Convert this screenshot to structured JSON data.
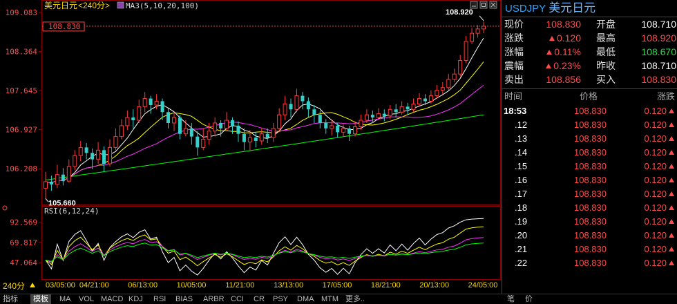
{
  "header": {
    "title": "美元日元",
    "period": "<240分>",
    "ma_label": "MA3(5,10,20,100)",
    "rsi_label": "RSI(6,12,24)",
    "current_price_tag": "108.830",
    "high_marker": "108.920",
    "low_marker": "105.660",
    "period_button": "240分"
  },
  "chart_data": {
    "type": "candlestick",
    "title": "美元日元 <240分>",
    "y_ticks": [
      "109.083",
      "108.364",
      "107.645",
      "106.927",
      "106.208"
    ],
    "ylim": [
      105.55,
      109.083
    ],
    "x_ticks": [
      "03/05:00",
      "04/21:00",
      "06/13:00",
      "10/05:00",
      "11/21:00",
      "13/13:00",
      "17/05:00",
      "18/21:00",
      "20/13:00",
      "24/05:00"
    ],
    "high": 108.92,
    "low": 105.66,
    "current": 108.83,
    "candles": [
      [
        105.85,
        105.97,
        105.66,
        106.15
      ],
      [
        105.97,
        105.92,
        105.8,
        106.08
      ],
      [
        105.92,
        106.1,
        105.85,
        106.28
      ],
      [
        106.1,
        105.98,
        105.9,
        106.22
      ],
      [
        105.98,
        106.25,
        105.95,
        106.38
      ],
      [
        106.25,
        106.45,
        106.18,
        106.55
      ],
      [
        106.45,
        106.6,
        106.35,
        106.72
      ],
      [
        106.6,
        106.5,
        106.38,
        106.68
      ],
      [
        106.5,
        106.38,
        106.2,
        106.58
      ],
      [
        106.38,
        106.55,
        106.3,
        106.7
      ],
      [
        106.55,
        106.3,
        106.15,
        106.62
      ],
      [
        106.3,
        106.6,
        106.25,
        106.75
      ],
      [
        106.6,
        106.8,
        106.55,
        106.95
      ],
      [
        106.8,
        107.0,
        106.75,
        107.12
      ],
      [
        107.0,
        107.15,
        106.92,
        107.28
      ],
      [
        107.15,
        107.1,
        106.95,
        107.3
      ],
      [
        107.1,
        107.35,
        107.05,
        107.48
      ],
      [
        107.35,
        107.5,
        107.25,
        107.62
      ],
      [
        107.5,
        107.38,
        107.22,
        107.55
      ],
      [
        107.38,
        107.45,
        107.3,
        107.58
      ],
      [
        107.45,
        107.25,
        107.1,
        107.5
      ],
      [
        107.25,
        107.05,
        106.95,
        107.32
      ],
      [
        107.05,
        107.15,
        106.9,
        107.25
      ],
      [
        107.15,
        106.85,
        106.75,
        107.2
      ],
      [
        106.85,
        106.95,
        106.8,
        107.1
      ],
      [
        106.95,
        106.8,
        106.65,
        107.05
      ],
      [
        106.8,
        106.6,
        106.45,
        106.9
      ],
      [
        106.6,
        106.75,
        106.55,
        106.95
      ],
      [
        106.75,
        106.9,
        106.65,
        107.05
      ],
      [
        106.9,
        107.05,
        106.8,
        107.15
      ],
      [
        107.05,
        106.95,
        106.8,
        107.1
      ],
      [
        106.95,
        107.1,
        106.9,
        107.25
      ],
      [
        107.1,
        107.0,
        106.85,
        107.15
      ],
      [
        107.0,
        106.85,
        106.7,
        107.08
      ],
      [
        106.85,
        106.7,
        106.55,
        106.95
      ],
      [
        106.7,
        106.78,
        106.55,
        106.92
      ],
      [
        106.78,
        106.72,
        106.6,
        106.88
      ],
      [
        106.72,
        106.85,
        106.65,
        106.95
      ],
      [
        106.85,
        106.78,
        106.68,
        106.95
      ],
      [
        106.78,
        106.95,
        106.7,
        107.05
      ],
      [
        106.95,
        107.2,
        106.9,
        107.32
      ],
      [
        107.2,
        107.4,
        107.1,
        107.55
      ],
      [
        107.4,
        107.3,
        107.15,
        107.5
      ],
      [
        107.3,
        107.55,
        107.25,
        107.68
      ],
      [
        107.55,
        107.45,
        107.3,
        107.62
      ],
      [
        107.45,
        107.3,
        107.15,
        107.52
      ],
      [
        107.3,
        107.2,
        107.05,
        107.38
      ],
      [
        107.2,
        107.05,
        106.95,
        107.28
      ],
      [
        107.05,
        106.95,
        106.85,
        107.12
      ],
      [
        106.95,
        107.0,
        106.82,
        107.1
      ],
      [
        107.0,
        106.88,
        106.78,
        107.05
      ],
      [
        106.88,
        106.95,
        106.8,
        107.02
      ],
      [
        106.95,
        106.85,
        106.72,
        107.0
      ],
      [
        106.85,
        106.98,
        106.8,
        107.08
      ],
      [
        106.98,
        107.1,
        106.92,
        107.2
      ],
      [
        107.1,
        107.2,
        107.05,
        107.3
      ],
      [
        107.2,
        107.15,
        107.05,
        107.28
      ],
      [
        107.15,
        107.22,
        107.1,
        107.32
      ],
      [
        107.22,
        107.18,
        107.08,
        107.3
      ],
      [
        107.18,
        107.3,
        107.12,
        107.38
      ],
      [
        107.3,
        107.25,
        107.15,
        107.4
      ],
      [
        107.25,
        107.35,
        107.2,
        107.45
      ],
      [
        107.35,
        107.3,
        107.2,
        107.42
      ],
      [
        107.3,
        107.4,
        107.25,
        107.5
      ],
      [
        107.4,
        107.5,
        107.35,
        107.6
      ],
      [
        107.5,
        107.45,
        107.38,
        107.58
      ],
      [
        107.45,
        107.55,
        107.4,
        107.65
      ],
      [
        107.55,
        107.65,
        107.5,
        107.75
      ],
      [
        107.65,
        107.7,
        107.58,
        107.8
      ],
      [
        107.7,
        107.85,
        107.65,
        107.95
      ],
      [
        107.85,
        107.95,
        107.8,
        108.05
      ],
      [
        107.95,
        108.2,
        107.9,
        108.3
      ],
      [
        108.2,
        108.55,
        108.15,
        108.65
      ],
      [
        108.55,
        108.7,
        108.5,
        108.8
      ],
      [
        108.7,
        108.78,
        108.62,
        108.85
      ],
      [
        108.78,
        108.83,
        108.7,
        108.92
      ]
    ],
    "ma_series": [
      {
        "name": "MA5",
        "color": "#ffffff"
      },
      {
        "name": "MA10",
        "color": "#ffff00"
      },
      {
        "name": "MA20",
        "color": "#ff33ff"
      },
      {
        "name": "MA100",
        "color": "#00ff00"
      }
    ],
    "rsi": {
      "y_ticks": [
        "92.569",
        "69.817",
        "47.064"
      ],
      "ylim": [
        30,
        100
      ],
      "series": [
        {
          "name": "RSI6",
          "color": "#ffffff"
        },
        {
          "name": "RSI12",
          "color": "#ffff00"
        },
        {
          "name": "RSI24",
          "color": "#ff33ff"
        }
      ]
    }
  },
  "quote": {
    "symbol": "USDJPY",
    "name": "美元日元",
    "rows": [
      {
        "k": "现价",
        "v": "108.830",
        "vc": "red",
        "k2": "开盘",
        "v2": "108.710",
        "v2c": "white"
      },
      {
        "k": "涨跌",
        "v": "0.120",
        "vc": "red",
        "arrow": true,
        "k2": "最高",
        "v2": "108.920",
        "v2c": "red"
      },
      {
        "k": "涨幅",
        "v": "0.11%",
        "vc": "red",
        "arrow": true,
        "k2": "最低",
        "v2": "108.670",
        "v2c": "green"
      },
      {
        "k": "震幅",
        "v": "0.23%",
        "vc": "red",
        "arrow": true,
        "k2": "昨收",
        "v2": "108.710",
        "v2c": "white"
      },
      {
        "k": "卖出",
        "v": "108.856",
        "vc": "red",
        "k2": "买入",
        "v2": "108.830",
        "v2c": "red"
      }
    ]
  },
  "ticks": {
    "headers": [
      "时间",
      "价格",
      "涨跌"
    ],
    "rows": [
      {
        "time": "18:53",
        "price": "108.830",
        "chg": "0.120"
      },
      {
        "time": ".12",
        "price": "108.830",
        "chg": "0.120"
      },
      {
        "time": ".13",
        "price": "108.830",
        "chg": "0.120"
      },
      {
        "time": ".14",
        "price": "108.830",
        "chg": "0.120"
      },
      {
        "time": ".15",
        "price": "108.830",
        "chg": "0.120"
      },
      {
        "time": ".16",
        "price": "108.830",
        "chg": "0.120"
      },
      {
        "time": ".17",
        "price": "108.830",
        "chg": "0.120"
      },
      {
        "time": ".18",
        "price": "108.830",
        "chg": "0.120"
      },
      {
        "time": ".19",
        "price": "108.830",
        "chg": "0.120"
      },
      {
        "time": ".20",
        "price": "108.830",
        "chg": "0.120"
      },
      {
        "time": ".21",
        "price": "108.830",
        "chg": "0.120"
      },
      {
        "time": ".22",
        "price": "108.830",
        "chg": "0.120"
      }
    ]
  },
  "bottom_bar": {
    "items": [
      "指标",
      "模板",
      "MA",
      "VOL",
      "MACD",
      "KDJ",
      "RSI",
      "BIAS",
      "ARBR",
      "CCI",
      "CR",
      "PSY",
      "DMA",
      "MTM",
      "更多.."
    ],
    "right_items": [
      "笔",
      "价"
    ]
  }
}
